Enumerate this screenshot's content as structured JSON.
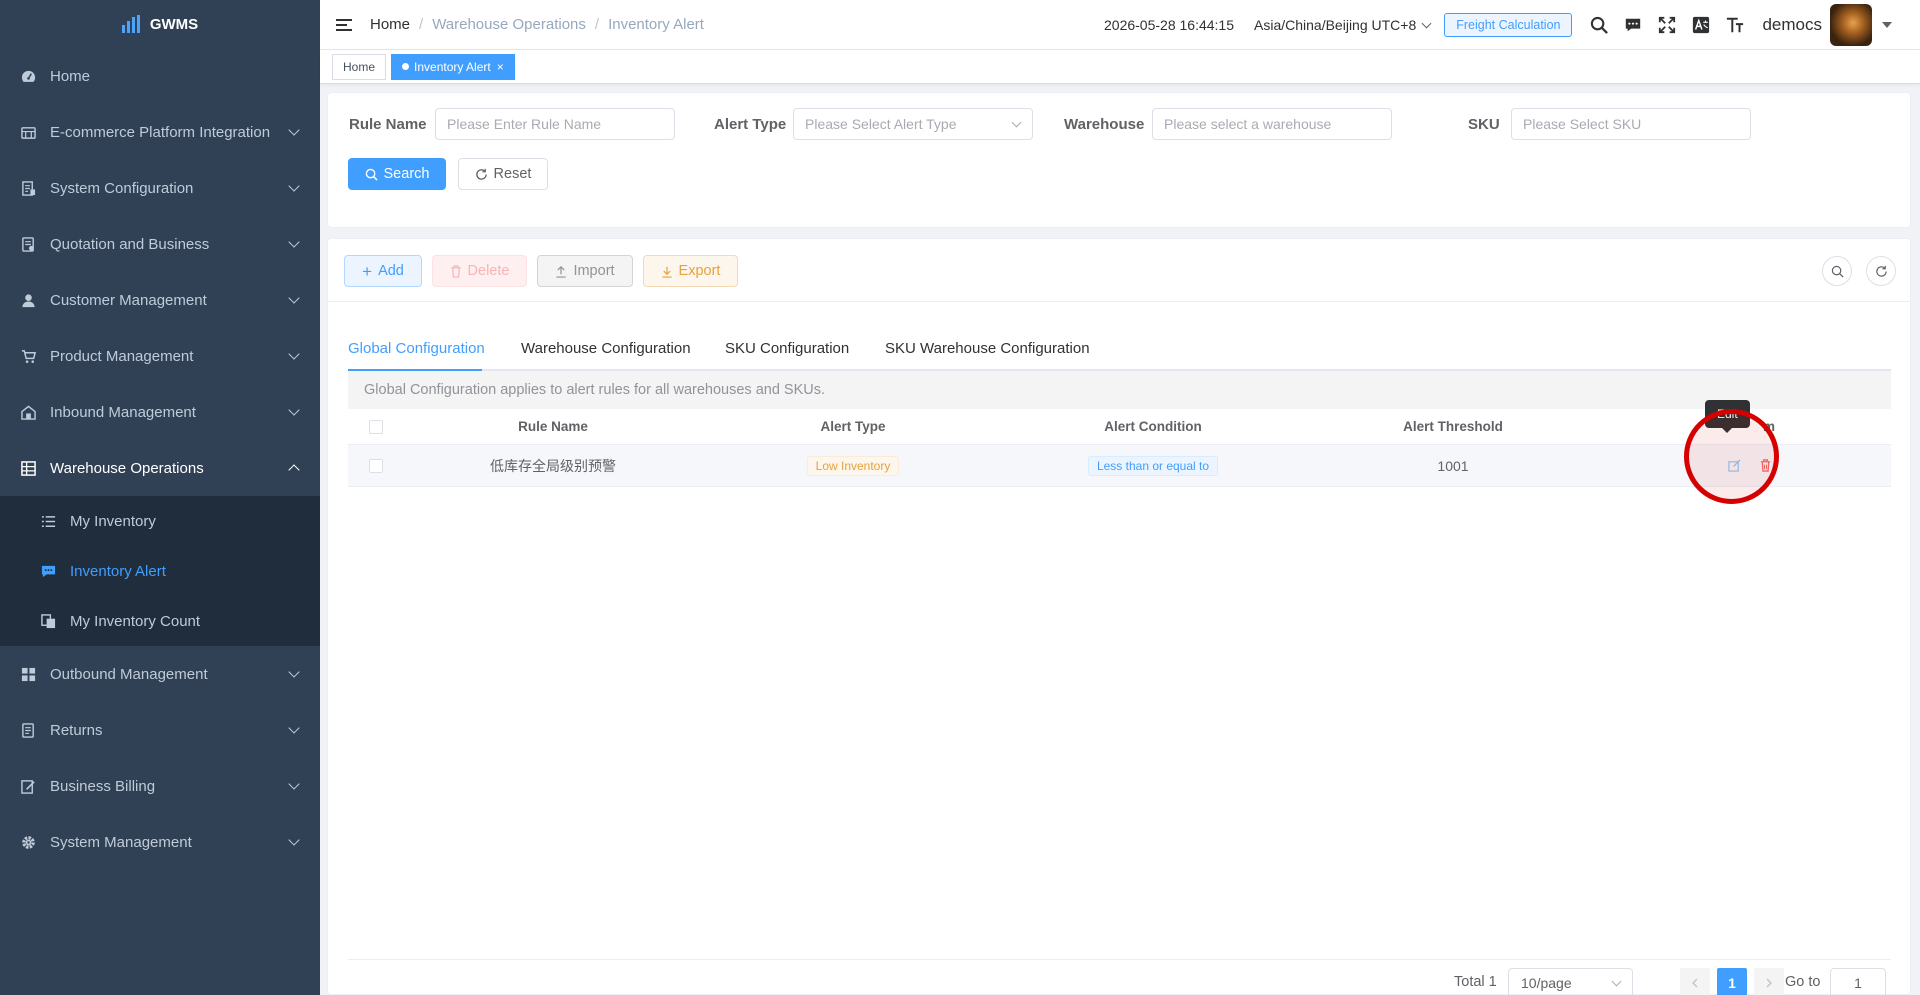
{
  "app": {
    "name": "GWMS"
  },
  "sidebar": {
    "items": [
      {
        "label": "Home",
        "icon": "dashboard-icon"
      },
      {
        "label": "E-commerce Platform Integration",
        "icon": "platform-icon"
      },
      {
        "label": "System Configuration",
        "icon": "config-icon"
      },
      {
        "label": "Quotation and Business",
        "icon": "quotation-icon"
      },
      {
        "label": "Customer Management",
        "icon": "user-icon"
      },
      {
        "label": "Product Management",
        "icon": "cart-icon"
      },
      {
        "label": "Inbound Management",
        "icon": "inbound-icon"
      },
      {
        "label": "Warehouse Operations",
        "icon": "grid-icon"
      },
      {
        "label": "Outbound Management",
        "icon": "outbound-icon"
      },
      {
        "label": "Returns",
        "icon": "returns-icon"
      },
      {
        "label": "Business Billing",
        "icon": "billing-icon"
      },
      {
        "label": "System Management",
        "icon": "gear-icon"
      }
    ],
    "submenu": [
      {
        "label": "My Inventory",
        "icon": "list-icon"
      },
      {
        "label": "Inventory Alert",
        "icon": "alert-icon"
      },
      {
        "label": "My Inventory Count",
        "icon": "count-icon"
      }
    ]
  },
  "header": {
    "breadcrumb": [
      "Home",
      "Warehouse Operations",
      "Inventory Alert"
    ],
    "separator": "/",
    "datetime": "2026-05-28 16:44:15",
    "timezone": "Asia/China/Beijing UTC+8",
    "freight_label": "Freight Calculation",
    "username": "democs"
  },
  "tagsview": {
    "tags": [
      {
        "label": "Home"
      },
      {
        "label": "Inventory Alert",
        "close": "×"
      }
    ]
  },
  "search": {
    "rule_name_label": "Rule Name",
    "rule_name_placeholder": "Please Enter Rule Name",
    "alert_type_label": "Alert Type",
    "alert_type_placeholder": "Please Select Alert Type",
    "warehouse_label": "Warehouse",
    "warehouse_placeholder": "Please select a warehouse",
    "sku_label": "SKU",
    "sku_placeholder": "Please Select SKU",
    "search_label": "Search",
    "reset_label": "Reset"
  },
  "toolbar": {
    "add_label": "Add",
    "delete_label": "Delete",
    "import_label": "Import",
    "export_label": "Export"
  },
  "tabs": [
    {
      "label": "Global Configuration"
    },
    {
      "label": "Warehouse Configuration"
    },
    {
      "label": "SKU Configuration"
    },
    {
      "label": "SKU Warehouse Configuration"
    }
  ],
  "info_text": "Global Configuration applies to alert rules for all warehouses and SKUs.",
  "table": {
    "columns": [
      "Rule Name",
      "Alert Type",
      "Alert Condition",
      "Alert Threshold",
      "m"
    ],
    "rows": [
      {
        "rule_name": "低库存全局级别预警",
        "alert_type": "Low Inventory",
        "alert_condition": "Less than or equal to",
        "alert_threshold": "1001"
      }
    ]
  },
  "tooltip": {
    "text": "Edit"
  },
  "pagination": {
    "total": "Total 1",
    "page_size": "10/page",
    "current_page": "1",
    "goto_label": "Go to",
    "goto_value": "1"
  },
  "colors": {
    "sidebar_bg": "#304156",
    "accent": "#409eff",
    "highlight_ring": "#d60000"
  }
}
